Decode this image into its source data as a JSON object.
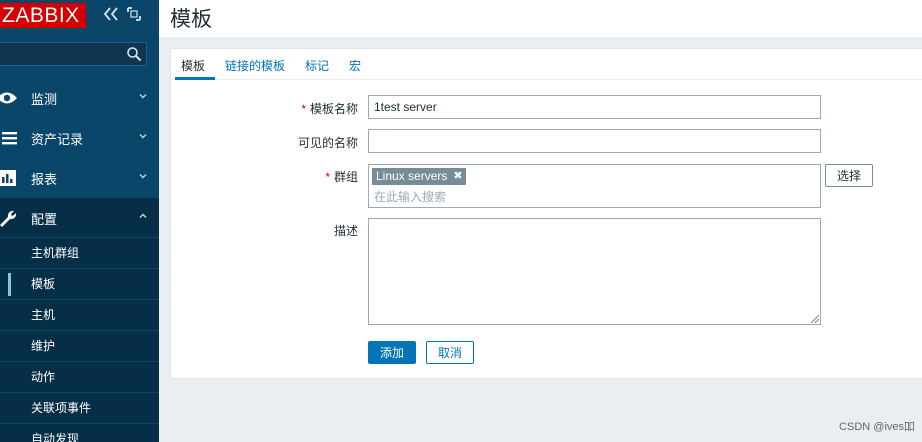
{
  "brand": {
    "logo": "ZABBIX",
    "logo_color": "#d40000",
    "sidebar_color": "#0a466a"
  },
  "sidebar": {
    "collapse_icon": "double-chevron-left-icon",
    "kiosk_icon": "kiosk-mode-icon",
    "search": {
      "value": "",
      "placeholder": ""
    },
    "menu": [
      {
        "label": "监测",
        "icon": "eye-icon"
      },
      {
        "label": "资产记录",
        "icon": "list-icon"
      },
      {
        "label": "报表",
        "icon": "bar-chart-icon"
      },
      {
        "label": "配置",
        "icon": "wrench-icon"
      }
    ],
    "submenu": [
      {
        "label": "主机群组"
      },
      {
        "label": "模板"
      },
      {
        "label": "主机"
      },
      {
        "label": "维护"
      },
      {
        "label": "动作"
      },
      {
        "label": "关联项事件"
      },
      {
        "label": "自动发现"
      }
    ]
  },
  "page": {
    "title": "模板"
  },
  "tabs": [
    {
      "label": "模板"
    },
    {
      "label": "链接的模板"
    },
    {
      "label": "标记"
    },
    {
      "label": "宏"
    }
  ],
  "form": {
    "required_mark": "*",
    "template_name": {
      "label": "模板名称",
      "value": "1test server"
    },
    "visible_name": {
      "label": "可见的名称",
      "value": ""
    },
    "groups": {
      "label": "群组",
      "tag": "Linux servers",
      "tag_remove": "✖",
      "placeholder": "在此输入搜索",
      "select_label": "选择"
    },
    "description": {
      "label": "描述",
      "value": ""
    },
    "add_label": "添加",
    "cancel_label": "取消"
  },
  "watermark": "CSDN @ives吅"
}
